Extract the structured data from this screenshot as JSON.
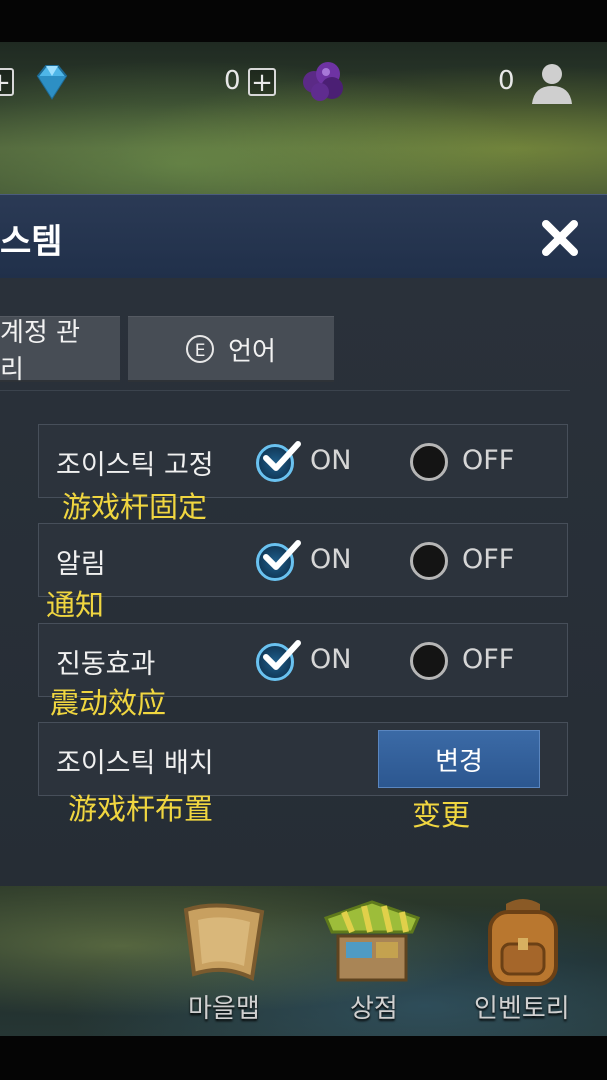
{
  "hud": {
    "gem_plus": "+",
    "middle_count": "0",
    "middle_plus": "+",
    "friends_count": "0"
  },
  "dialog": {
    "title": "스템",
    "close_icon": "close-icon"
  },
  "tabs": [
    {
      "label": "계정 관리"
    },
    {
      "icon_letter": "E",
      "label": "언어"
    }
  ],
  "settings": [
    {
      "label": "조이스틱 고정",
      "cn": "游戏杆固定",
      "on_label": "ON",
      "off_label": "OFF",
      "selected": "on"
    },
    {
      "label": "알림",
      "cn": "通知",
      "on_label": "ON",
      "off_label": "OFF",
      "selected": "on"
    },
    {
      "label": "진동효과",
      "cn": "震动效应",
      "on_label": "ON",
      "off_label": "OFF",
      "selected": "on"
    }
  ],
  "joystick_layout": {
    "label": "조이스틱 배치",
    "cn": "游戏杆布置",
    "button_label": "변경",
    "button_cn": "变更"
  },
  "bottom_nav": [
    {
      "label": "마을맵",
      "icon": "map-scroll-icon"
    },
    {
      "label": "상점",
      "icon": "shop-stall-icon"
    },
    {
      "label": "인벤토리",
      "icon": "backpack-icon"
    }
  ],
  "colors": {
    "accent_check": "#6ac2f0",
    "annotation": "#f0d640",
    "button_blue": "#3b6aa6",
    "header_blue": "#2b3a55"
  }
}
